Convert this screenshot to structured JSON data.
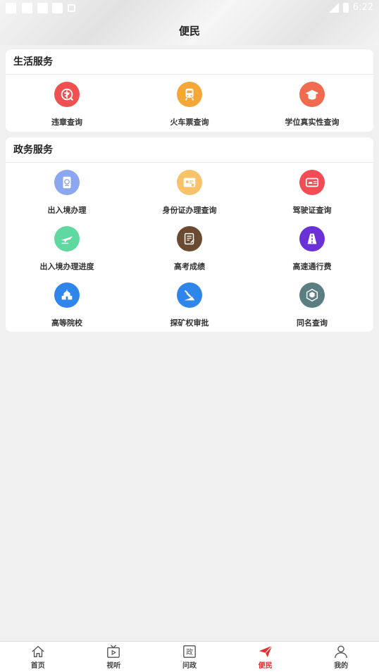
{
  "status_bar": {
    "time": "6:22"
  },
  "header": {
    "title": "便民"
  },
  "sections": {
    "life": {
      "title": "生活服务",
      "items": [
        {
          "label": "违章查询",
          "icon": "violation-icon",
          "color": "#f0504f"
        },
        {
          "label": "火车票查询",
          "icon": "train-icon",
          "color": "#f4a637"
        },
        {
          "label": "学位真实性查询",
          "icon": "graduation-cap-icon",
          "color": "#f06b4f"
        }
      ]
    },
    "gov": {
      "title": "政务服务",
      "items": [
        {
          "label": "出入境办理",
          "icon": "passport-icon",
          "color": "#8aa7f0"
        },
        {
          "label": "身份证办理查询",
          "icon": "id-card-icon",
          "color": "#f7c26a"
        },
        {
          "label": "驾驶证查询",
          "icon": "driver-license-icon",
          "color": "#f24c55"
        },
        {
          "label": "出入境办理进度",
          "icon": "airplane-icon",
          "color": "#5fd9a0"
        },
        {
          "label": "高考成绩",
          "icon": "exam-paper-icon",
          "color": "#6b4a32"
        },
        {
          "label": "高速通行费",
          "icon": "highway-icon",
          "color": "#6a32d6"
        },
        {
          "label": "高等院校",
          "icon": "university-icon",
          "color": "#2f86ea"
        },
        {
          "label": "探矿权审批",
          "icon": "mining-icon",
          "color": "#2f86ea"
        },
        {
          "label": "同名查询",
          "icon": "cube-icon",
          "color": "#5a7e82"
        }
      ]
    }
  },
  "tabbar": {
    "active": "便民",
    "accent_color": "#e23030",
    "items": [
      {
        "label": "首页",
        "icon": "home-icon"
      },
      {
        "label": "视听",
        "icon": "tv-icon"
      },
      {
        "label": "问政",
        "icon": "gov-icon",
        "glyph": "政"
      },
      {
        "label": "便民",
        "icon": "paper-plane-icon"
      },
      {
        "label": "我的",
        "icon": "person-icon"
      }
    ]
  }
}
